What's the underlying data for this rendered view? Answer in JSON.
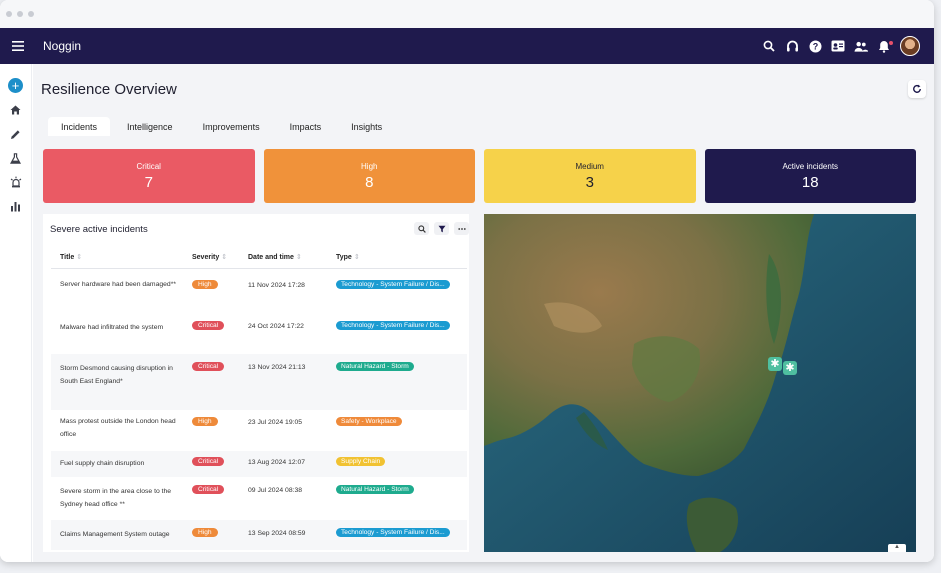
{
  "app": {
    "name": "Noggin"
  },
  "page": {
    "title": "Resilience Overview"
  },
  "tabs": [
    {
      "label": "Incidents",
      "active": true
    },
    {
      "label": "Intelligence",
      "active": false
    },
    {
      "label": "Improvements",
      "active": false
    },
    {
      "label": "Impacts",
      "active": false
    },
    {
      "label": "Insights",
      "active": false
    }
  ],
  "summary": [
    {
      "label": "Critical",
      "value": "7",
      "color": "#ea5a64",
      "text_color": "#ffffff"
    },
    {
      "label": "High",
      "value": "8",
      "color": "#f0923a",
      "text_color": "#ffffff"
    },
    {
      "label": "Medium",
      "value": "3",
      "color": "#f6d24a",
      "text_color": "#1f1f2f"
    },
    {
      "label": "Active incidents",
      "value": "18",
      "color": "#1f1a4d",
      "text_color": "#ffffff"
    }
  ],
  "incidents_panel": {
    "title": "Severe active incidents",
    "columns": [
      "Title",
      "Severity",
      "Date and time",
      "Type"
    ],
    "rows": [
      {
        "title": "Server hardware had been damaged**",
        "severity": "High",
        "date": "11 Nov 2024 17:28",
        "type": "Technology - System Failure / Dis..."
      },
      {
        "title": "Malware had infiltrated the system",
        "severity": "Critical",
        "date": "24 Oct 2024 17:22",
        "type": "Technology - System Failure / Dis..."
      },
      {
        "title": "Storm Desmond causing disruption in South East England*",
        "severity": "Critical",
        "date": "13 Nov 2024 21:13",
        "type": "Natural Hazard - Storm"
      },
      {
        "title": "Mass protest outside the London head office",
        "severity": "High",
        "date": "23 Jul 2024 19:05",
        "type": "Safety - Workplace"
      },
      {
        "title": "Fuel supply chain disruption",
        "severity": "Critical",
        "date": "13 Aug 2024 12:07",
        "type": "Supply Chain"
      },
      {
        "title": "Severe storm in the area close to the Sydney head office **",
        "severity": "Critical",
        "date": "09 Jul 2024 08:38",
        "type": "Natural Hazard - Storm"
      },
      {
        "title": "Claims Management System outage",
        "severity": "High",
        "date": "13 Sep 2024 08:59",
        "type": "Technology - System Failure / Dis..."
      }
    ]
  },
  "colors": {
    "severity": {
      "High": "#ee8a3a",
      "Critical": "#e0505a"
    },
    "type": {
      "Technology - System Failure / Dis...": "#1b9bd1",
      "Natural Hazard - Storm": "#1eab8e",
      "Safety - Workplace": "#ef8a3a",
      "Supply Chain": "#f1c232"
    }
  },
  "icons": {
    "topbar": [
      "search-icon",
      "headset-icon",
      "help-icon",
      "contact-card-icon",
      "people-icon",
      "bell-icon"
    ],
    "nav": [
      "add-icon",
      "home-icon",
      "pencil-icon",
      "flask-icon",
      "alarm-icon",
      "chart-icon"
    ]
  }
}
